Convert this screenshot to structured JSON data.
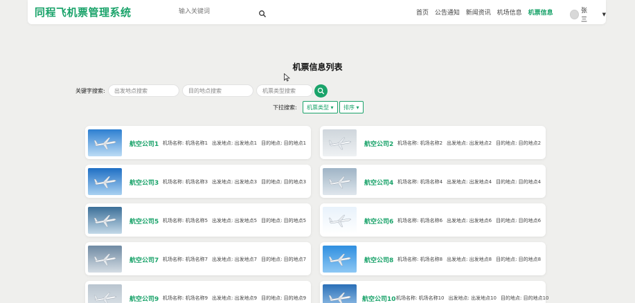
{
  "header": {
    "brand": "同程飞机票管理系统",
    "search_placeholder": "输入关键词",
    "nav": [
      "首页",
      "公告通知",
      "新闻资讯",
      "机场信息",
      "机票信息"
    ],
    "nav_active_index": 4,
    "user_name": "张三"
  },
  "page_title": "机票信息列表",
  "filters": {
    "keyword_label": "关键字搜索:",
    "departure_placeholder": "出发地点搜索",
    "destination_placeholder": "目的地点搜索",
    "ticket_type_placeholder": "机票类型搜索",
    "dropdown_label": "下拉搜索:",
    "ticket_type_button": "机票类型",
    "sort_button": "排序"
  },
  "colors": {
    "accent": "#1aa36a"
  },
  "tickets": [
    {
      "airline": "航空公司1",
      "airport": "机场名称: 机场名称1",
      "departure": "出发地点: 出发地点1",
      "destination": "目的地点: 目的地点1"
    },
    {
      "airline": "航空公司2",
      "airport": "机场名称: 机场名称2",
      "departure": "出发地点: 出发地点2",
      "destination": "目的地点: 目的地点2"
    },
    {
      "airline": "航空公司3",
      "airport": "机场名称: 机场名称3",
      "departure": "出发地点: 出发地点3",
      "destination": "目的地点: 目的地点3"
    },
    {
      "airline": "航空公司4",
      "airport": "机场名称: 机场名称4",
      "departure": "出发地点: 出发地点4",
      "destination": "目的地点: 目的地点4"
    },
    {
      "airline": "航空公司5",
      "airport": "机场名称: 机场名称5",
      "departure": "出发地点: 出发地点5",
      "destination": "目的地点: 目的地点5"
    },
    {
      "airline": "航空公司6",
      "airport": "机场名称: 机场名称6",
      "departure": "出发地点: 出发地点6",
      "destination": "目的地点: 目的地点6"
    },
    {
      "airline": "航空公司7",
      "airport": "机场名称: 机场名称7",
      "departure": "出发地点: 出发地点7",
      "destination": "目的地点: 目的地点7"
    },
    {
      "airline": "航空公司8",
      "airport": "机场名称: 机场名称8",
      "departure": "出发地点: 出发地点8",
      "destination": "目的地点: 目的地点8"
    },
    {
      "airline": "航空公司9",
      "airport": "机场名称: 机场名称9",
      "departure": "出发地点: 出发地点9",
      "destination": "目的地点: 目的地点9"
    },
    {
      "airline": "航空公司10",
      "airport": "机场名称: 机场名称10",
      "departure": "出发地点: 出发地点10",
      "destination": "目的地点: 目的地点10"
    }
  ]
}
